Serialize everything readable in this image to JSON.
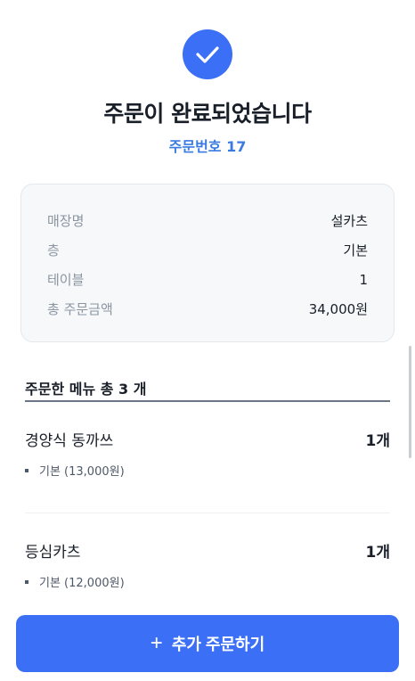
{
  "header": {
    "icon": "check-icon",
    "title": "주문이 완료되었습니다",
    "order_number": "주문번호 17"
  },
  "info": [
    {
      "label": "매장명",
      "value": "설카츠"
    },
    {
      "label": "층",
      "value": "기본"
    },
    {
      "label": "테이블",
      "value": "1"
    },
    {
      "label": "총 주문금액",
      "value": "34,000원"
    }
  ],
  "menu": {
    "header": "주문한 메뉴 총 3 개",
    "items": [
      {
        "name": "경양식 동까쓰",
        "qty": "1개",
        "option": "기본 (13,000원)"
      },
      {
        "name": "등심카츠",
        "qty": "1개",
        "option": "기본 (12,000원)"
      }
    ]
  },
  "action": {
    "plus_icon": "plus-icon",
    "label": "추가 주문하기"
  },
  "colors": {
    "accent": "#3b6ff5",
    "order_number": "#3b7be0"
  }
}
